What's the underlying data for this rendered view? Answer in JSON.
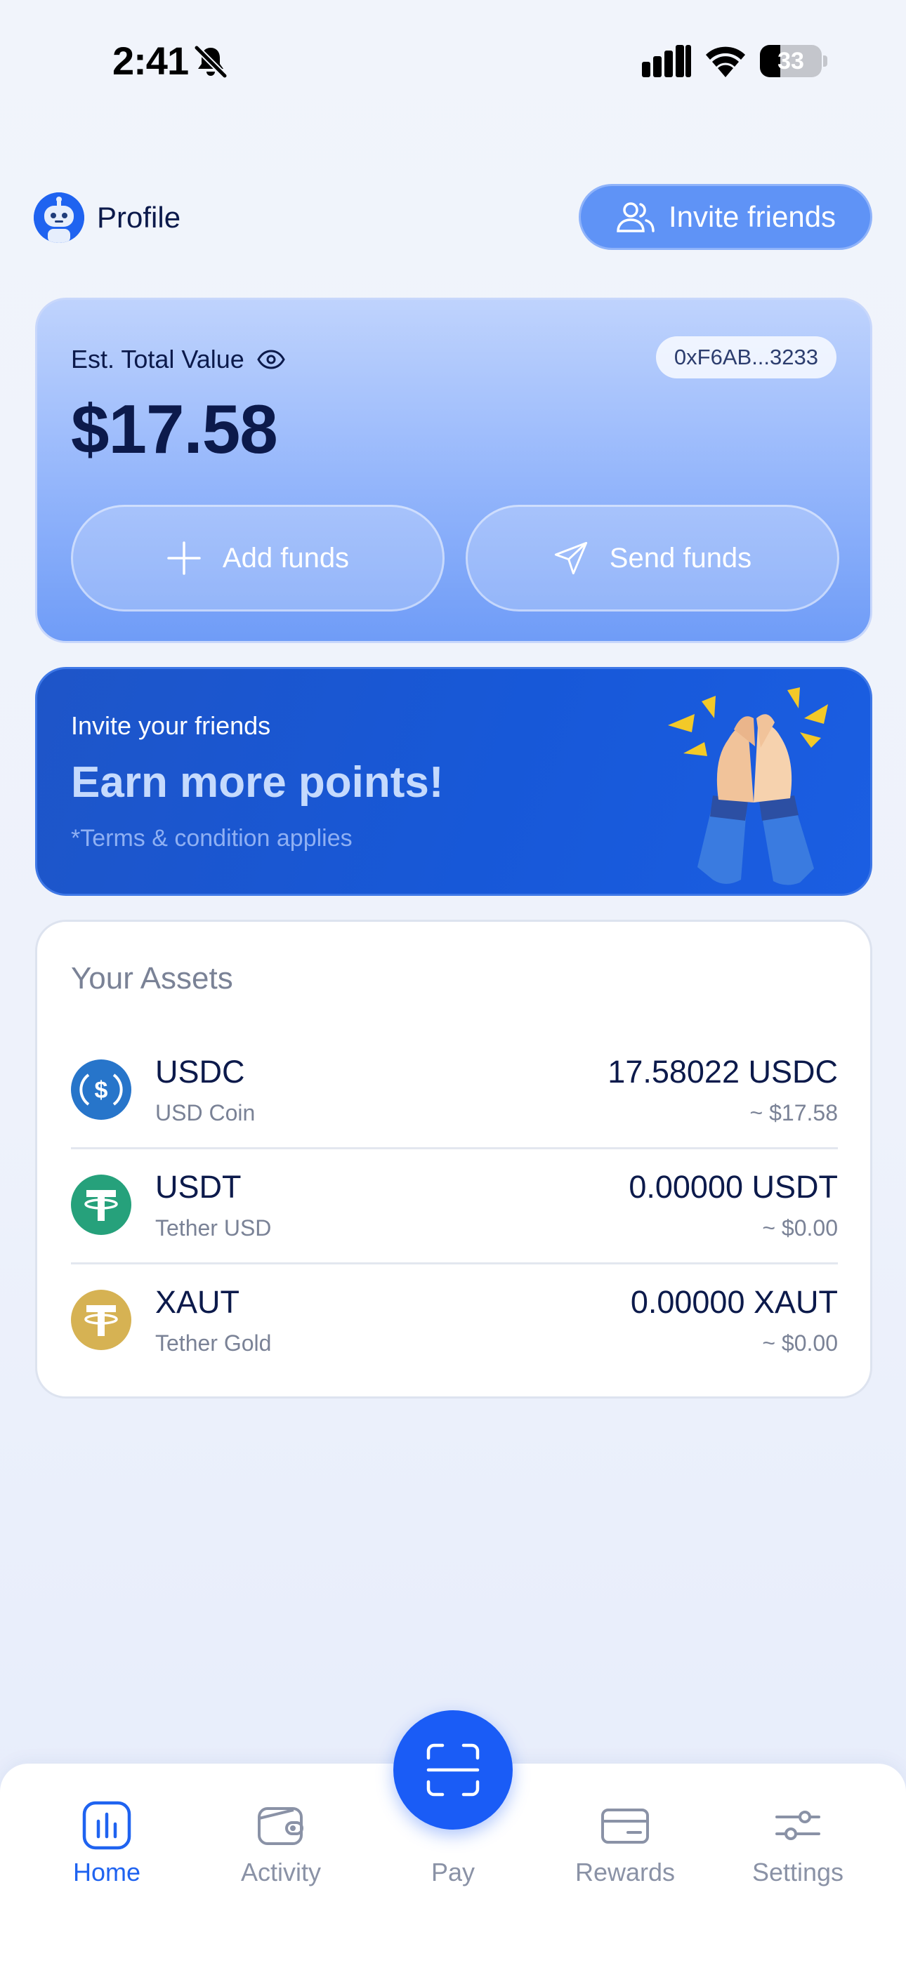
{
  "status_bar": {
    "time": "2:41",
    "battery": "33",
    "battery_level": 0.33
  },
  "header": {
    "profile_label": "Profile",
    "invite_button": "Invite friends"
  },
  "balance": {
    "label": "Est. Total Value",
    "address": "0xF6AB...3233",
    "total": "$17.58",
    "add_funds": "Add funds",
    "send_funds": "Send funds"
  },
  "promo": {
    "kicker": "Invite your friends",
    "title": "Earn more points!",
    "terms": "*Terms & condition applies"
  },
  "assets": {
    "title": "Your Assets",
    "items": [
      {
        "symbol": "USDC",
        "name": "USD Coin",
        "amount": "17.58022 USDC",
        "fiat": "~ $17.58",
        "icon": "usdc-coin-icon",
        "color": "#2775ca"
      },
      {
        "symbol": "USDT",
        "name": "Tether USD",
        "amount": "0.00000 USDT",
        "fiat": "~ $0.00",
        "icon": "tether-coin-icon",
        "color": "#26a17b"
      },
      {
        "symbol": "XAUT",
        "name": "Tether Gold",
        "amount": "0.00000 XAUT",
        "fiat": "~ $0.00",
        "icon": "tether-gold-coin-icon",
        "color": "#d6b253"
      }
    ]
  },
  "tab_bar": {
    "home": "Home",
    "activity": "Activity",
    "pay": "Pay",
    "rewards": "Rewards",
    "settings": "Settings",
    "active": "home"
  },
  "colors": {
    "accent": "#1f63f0",
    "pay_button": "#1a5cf6",
    "promo_background": "#1758d8"
  }
}
